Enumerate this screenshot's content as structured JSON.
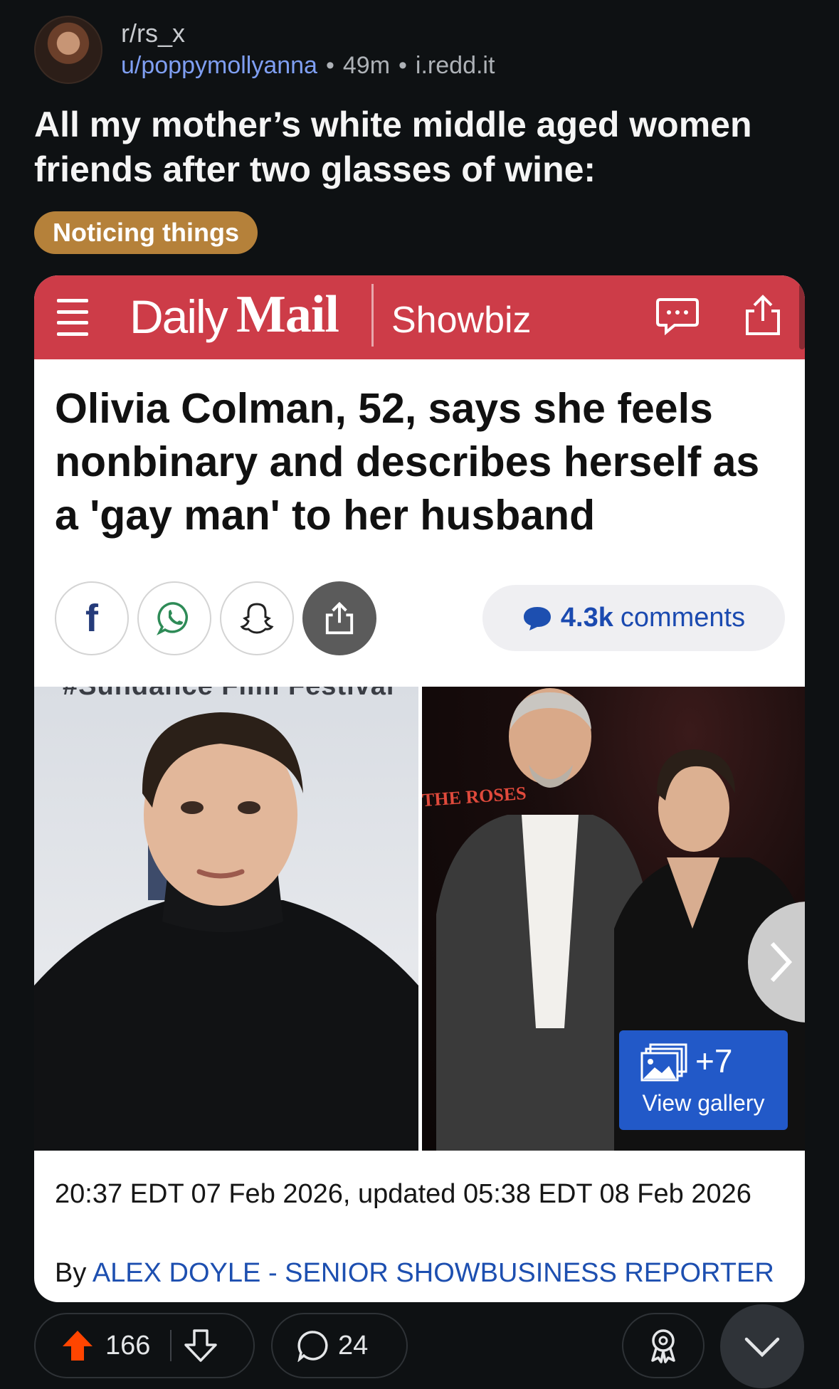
{
  "post": {
    "subreddit": "r/rs_x",
    "author": "u/poppymollyanna",
    "age": "49m",
    "domain": "i.redd.it",
    "separator": "•",
    "title": "All my mother’s white middle aged women friends after two glasses of wine:",
    "flair": "Noticing things",
    "flair_color": "#b5813a"
  },
  "image": {
    "brand_daily": "Daily",
    "brand_mail": "Mail",
    "section": "Showbiz",
    "brand_color": "#cd3c48",
    "headline": "Olivia Colman, 52, says she feels nonbinary and describes herself as a 'gay man' to her husband",
    "share_icons": [
      "facebook-icon",
      "whatsapp-icon",
      "snapchat-icon",
      "share-icon"
    ],
    "facebook_glyph": "f",
    "comments_count": "4.3k",
    "comments_label": "comments",
    "photo_banner": "#Sundance Film Festival",
    "venue_sign": "THE ROSES",
    "gallery_count": "+7",
    "gallery_label": "View gallery",
    "dateline": "20:37 EDT 07 Feb 2026, updated 05:38 EDT 08 Feb 2026",
    "byline_prefix": "By",
    "byline_author": "ALEX DOYLE - SENIOR SHOWBUSINESS REPORTER",
    "link_color": "#1d4fb0"
  },
  "actions": {
    "upvotes": "166",
    "comments": "24",
    "upvote_color": "#ff4500"
  }
}
